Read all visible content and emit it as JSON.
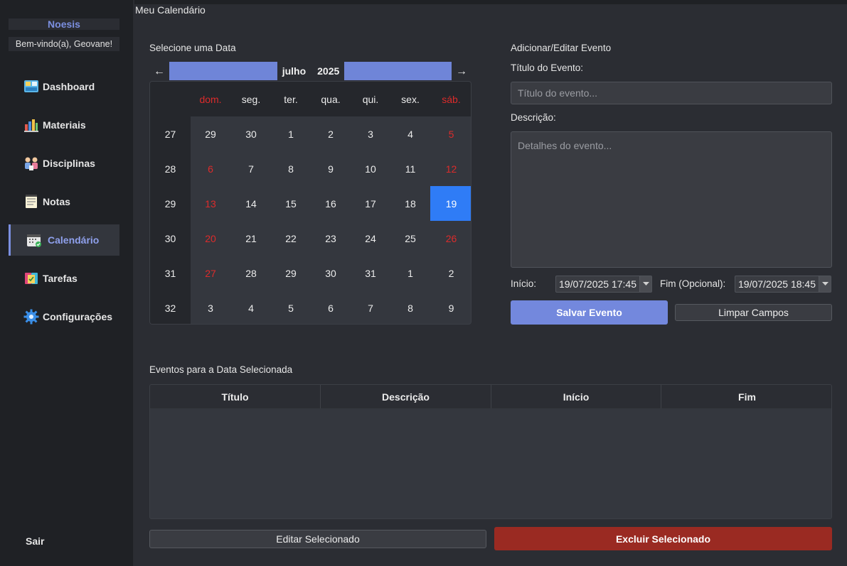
{
  "sidebar": {
    "brand": "Noesis",
    "welcome": "Bem-vindo(a), Geovane!",
    "items": [
      {
        "label": "Dashboard",
        "icon": "dashboard-icon"
      },
      {
        "label": "Materiais",
        "icon": "materials-icon"
      },
      {
        "label": "Disciplinas",
        "icon": "disciplines-icon"
      },
      {
        "label": "Notas",
        "icon": "notes-icon"
      },
      {
        "label": "Calendário",
        "icon": "calendar-icon",
        "active": true
      },
      {
        "label": "Tarefas",
        "icon": "tasks-icon"
      },
      {
        "label": "Configurações",
        "icon": "gear-icon"
      }
    ],
    "logout": "Sair"
  },
  "page": {
    "title": "Meu Calendário"
  },
  "calendar": {
    "section_label": "Selecione uma Data",
    "month": "julho",
    "year": "2025",
    "weekdays": [
      "dom.",
      "seg.",
      "ter.",
      "qua.",
      "qui.",
      "sex.",
      "sáb."
    ],
    "week_numbers": [
      "27",
      "28",
      "29",
      "30",
      "31",
      "32"
    ],
    "days": [
      [
        "29",
        "30",
        "1",
        "2",
        "3",
        "4",
        "5"
      ],
      [
        "6",
        "7",
        "8",
        "9",
        "10",
        "11",
        "12"
      ],
      [
        "13",
        "14",
        "15",
        "16",
        "17",
        "18",
        "19"
      ],
      [
        "20",
        "21",
        "22",
        "23",
        "24",
        "25",
        "26"
      ],
      [
        "27",
        "28",
        "29",
        "30",
        "31",
        "1",
        "2"
      ],
      [
        "3",
        "4",
        "5",
        "6",
        "7",
        "8",
        "9"
      ]
    ],
    "selected_day": "19",
    "colors": {
      "weekend": "#dc2b2b",
      "selected": "#2f7cf6",
      "accent": "#6f85d8"
    }
  },
  "event_form": {
    "section_label": "Adicionar/Editar Evento",
    "title_label": "Título do Evento:",
    "title_placeholder": "Título do evento...",
    "description_label": "Descrição:",
    "description_placeholder": "Detalhes do evento...",
    "start_label": "Início:",
    "start_value": "19/07/2025 17:45",
    "end_label": "Fim (Opcional):",
    "end_value": "19/07/2025 18:45",
    "save_button": "Salvar Evento",
    "clear_button": "Limpar Campos"
  },
  "events": {
    "section_label": "Eventos para a Data Selecionada",
    "columns": [
      "Título",
      "Descrição",
      "Início",
      "Fim"
    ],
    "rows": [],
    "edit_button": "Editar Selecionado",
    "delete_button": "Excluir Selecionado"
  }
}
